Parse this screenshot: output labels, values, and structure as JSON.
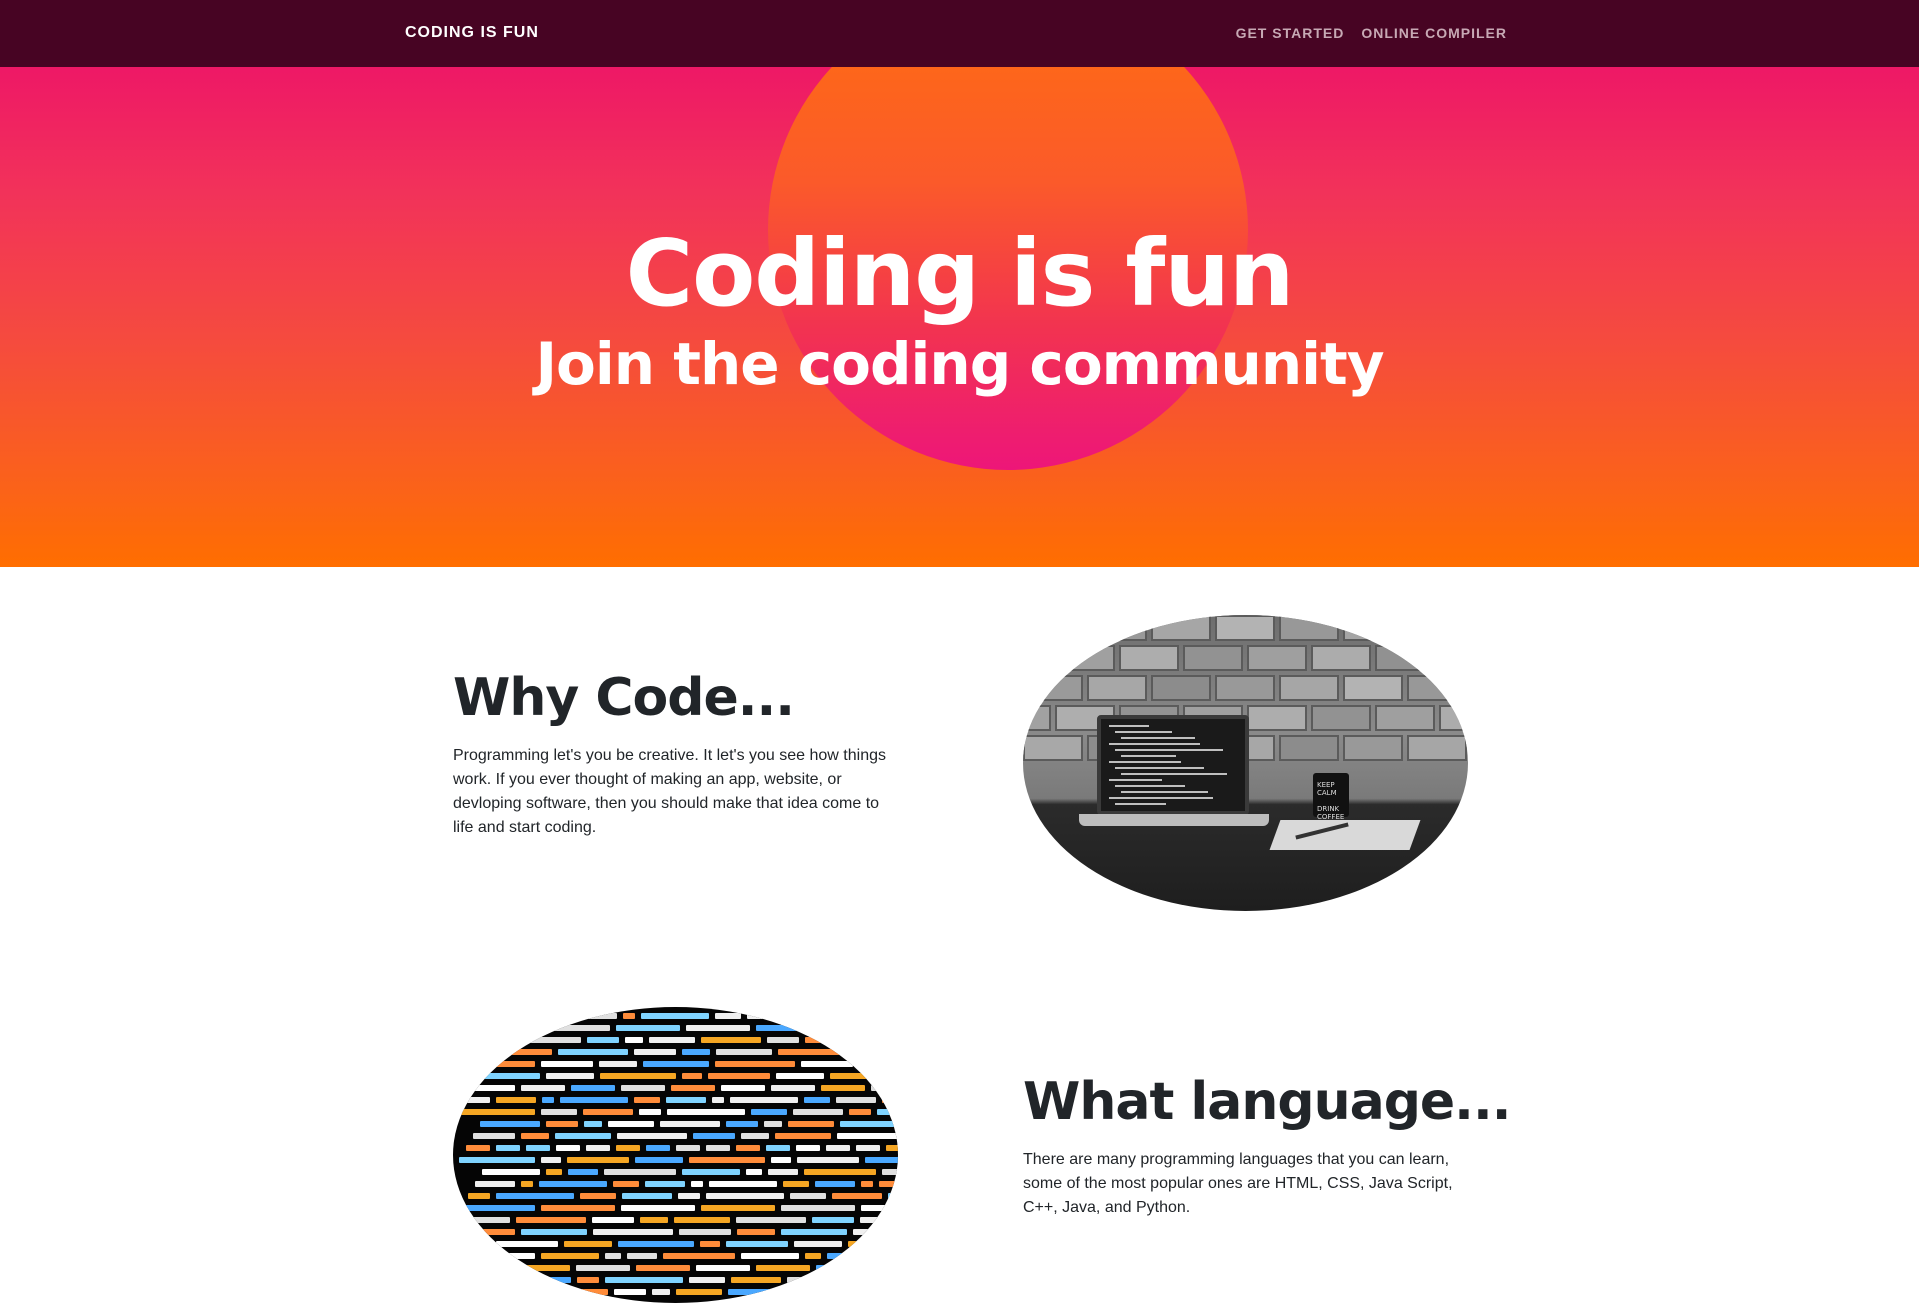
{
  "navbar": {
    "brand": "CODING IS FUN",
    "links": [
      "GET STARTED",
      "ONLINE COMPILER"
    ]
  },
  "hero": {
    "title": "Coding is fun",
    "subtitle": "Join the coding community"
  },
  "sections": [
    {
      "heading": "Why Code...",
      "text": "Programming let's you be creative. It let's you see how things work. If you ever thought of making an app, website, or devloping software, then you should make that idea come to life and start coding.",
      "image": "laptop-on-desk-photo"
    },
    {
      "heading": "What language...",
      "text": "There are many programming languages that you can learn, some of the most popular ones are HTML, CSS, Java Script, C++, Java, and Python.",
      "image": "code-screen-photo"
    }
  ],
  "colors": {
    "navbar_bg": "#470423",
    "hero_top": "#ee1866",
    "hero_bottom": "#ff6e00",
    "heading_text": "#212529"
  }
}
